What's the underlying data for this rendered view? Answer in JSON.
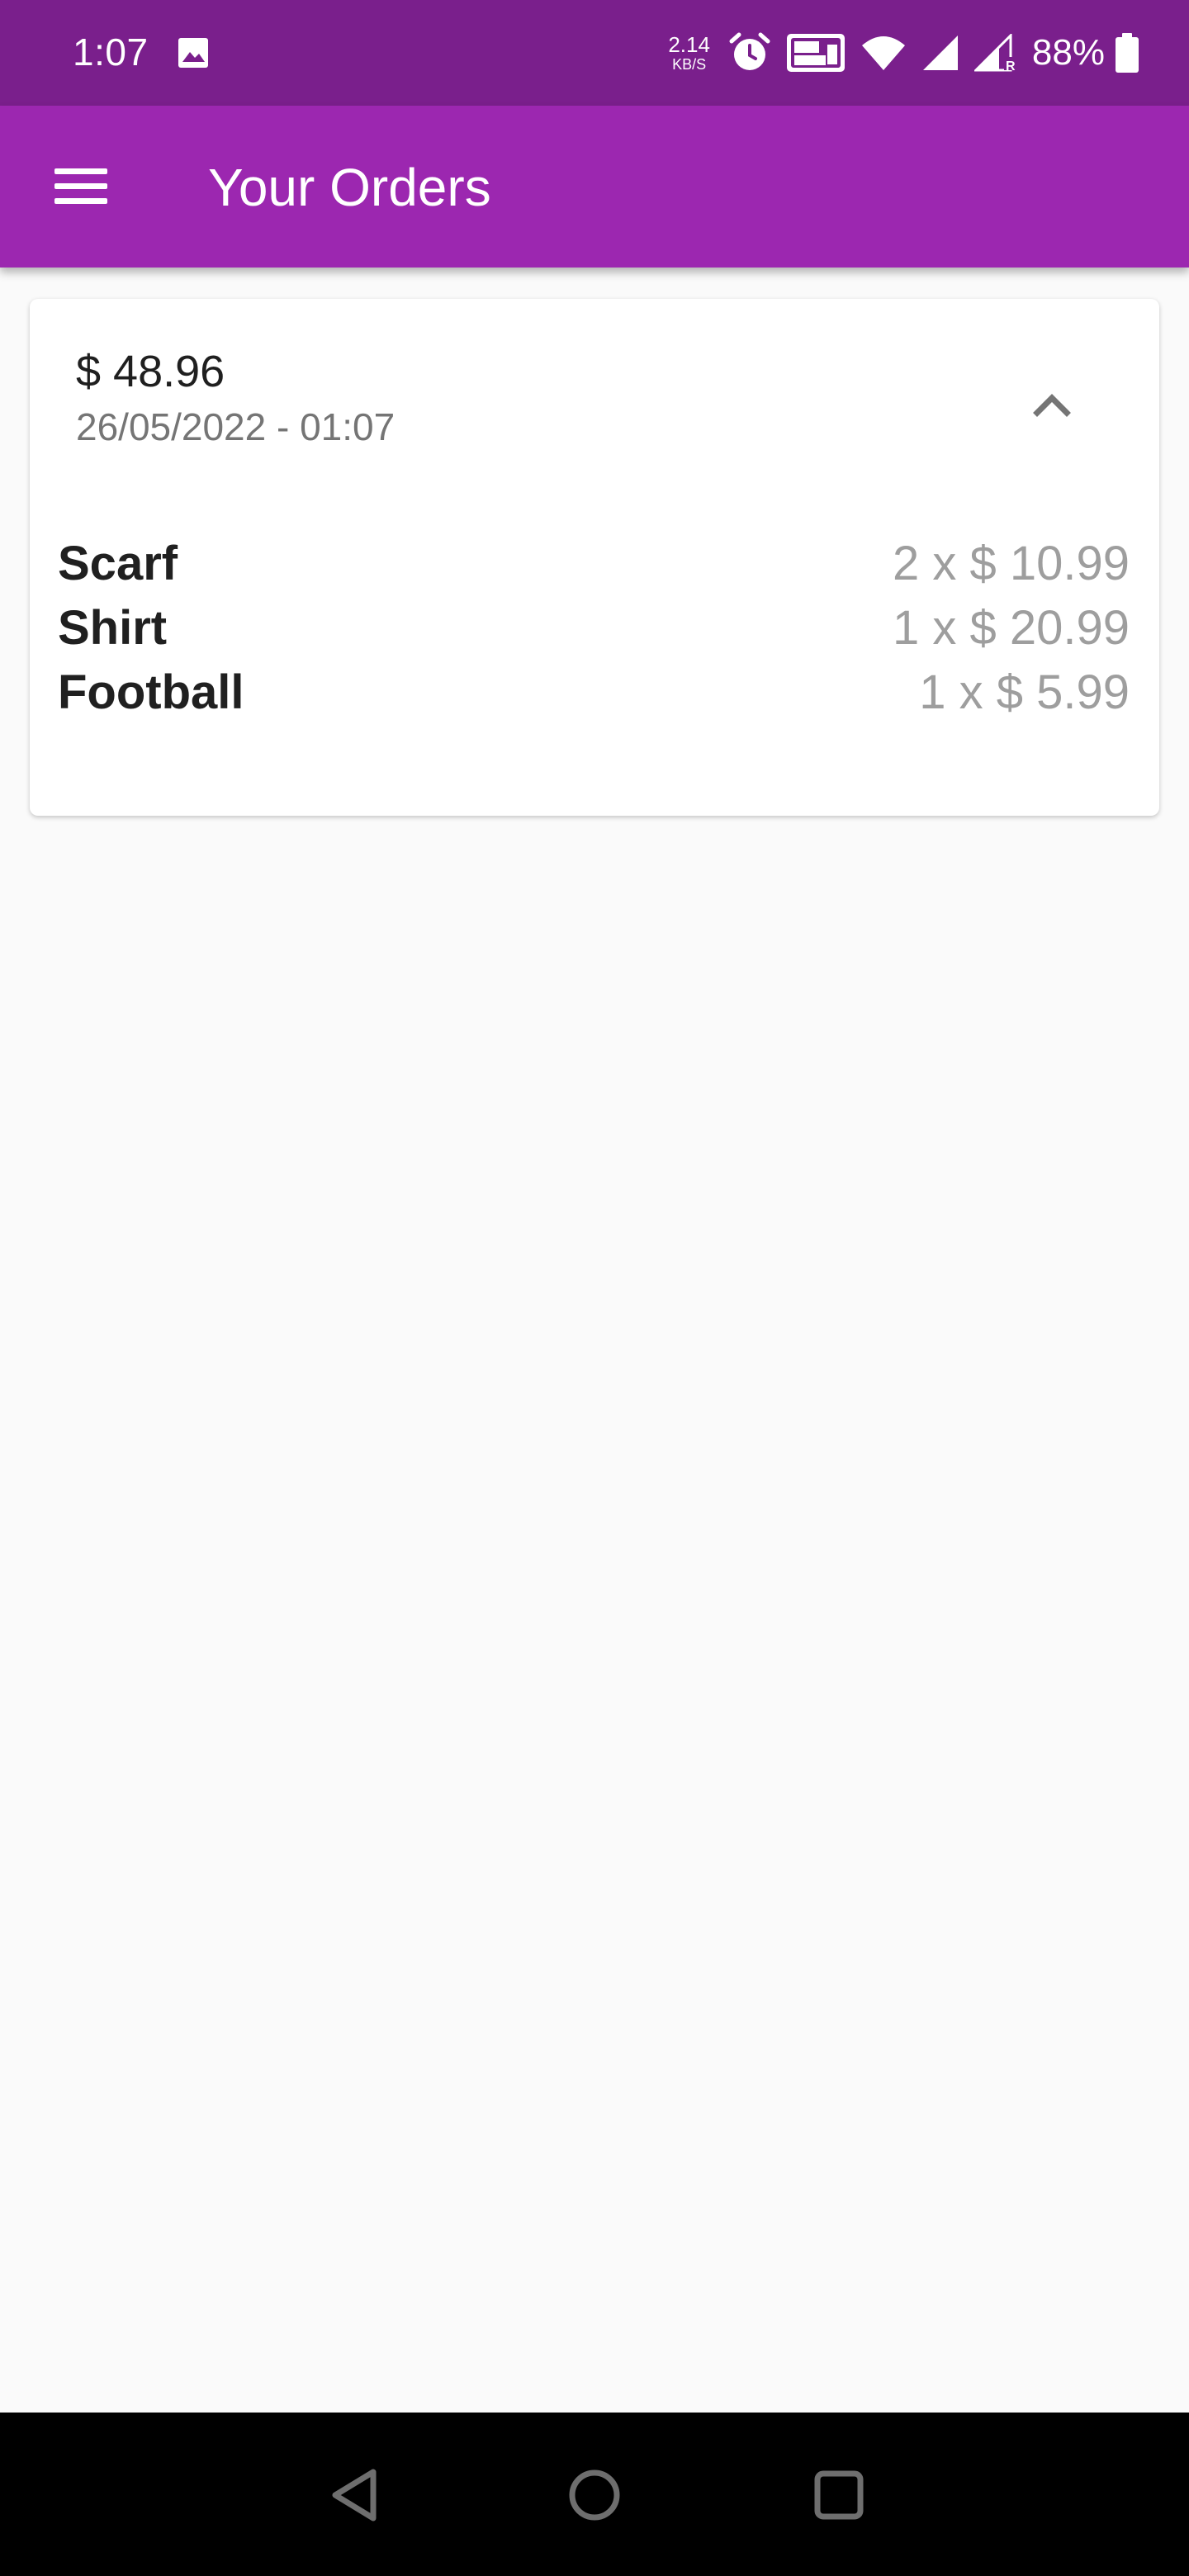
{
  "status_bar": {
    "time": "1:07",
    "net_speed_value": "2.14",
    "net_speed_unit": "KB/S",
    "battery_percent": "88%",
    "icons": [
      "image-icon",
      "alarm-icon",
      "vowifi-icon",
      "wifi-icon",
      "signal-icon",
      "signal-roaming-icon",
      "battery-icon"
    ]
  },
  "app_bar": {
    "title": "Your Orders",
    "menu_icon": "hamburger-menu-icon",
    "color": "#9c27b0"
  },
  "order": {
    "total": "$ 48.96",
    "date": "26/05/2022 - 01:07",
    "expanded": true,
    "toggle_icon": "chevron-up-icon",
    "items": [
      {
        "name": "Scarf",
        "qty_price": "2 x $ 10.99"
      },
      {
        "name": "Shirt",
        "qty_price": "1 x $ 20.99"
      },
      {
        "name": "Football",
        "qty_price": "1 x $ 5.99"
      }
    ]
  },
  "nav_bar": {
    "buttons": [
      "back-icon",
      "home-icon",
      "recents-icon"
    ]
  }
}
